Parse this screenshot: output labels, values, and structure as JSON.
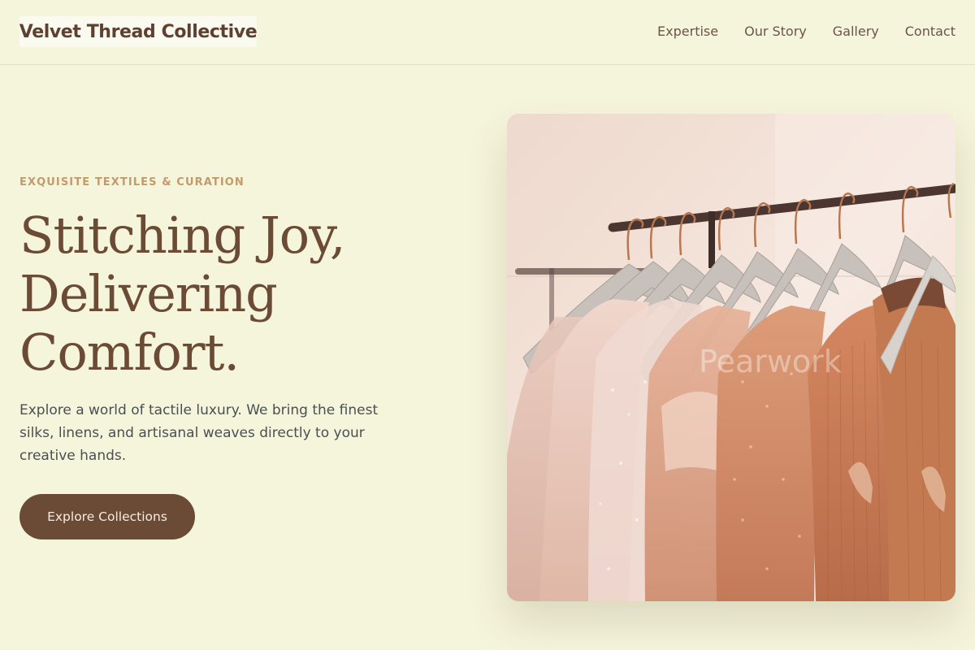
{
  "header": {
    "logo_text": "Velvet Thread Collective",
    "nav": [
      {
        "label": "Expertise"
      },
      {
        "label": "Our Story"
      },
      {
        "label": "Gallery"
      },
      {
        "label": "Contact"
      }
    ]
  },
  "hero": {
    "eyebrow": "EXQUISITE TEXTILES & CURATION",
    "headline_lines": [
      "Stitching Joy,",
      "Delivering",
      "Comfort."
    ],
    "lead": "Explore a world of tactile luxury. We bring the finest silks, linens, and artisanal weaves directly to your creative hands.",
    "cta_label": "Explore Collections",
    "image_watermark": "Pearwork"
  },
  "colors": {
    "background": "#f5f5dc",
    "brand_brown": "#6b4a36",
    "accent_tan": "#c49a6c",
    "body_text": "#4a4f52"
  }
}
